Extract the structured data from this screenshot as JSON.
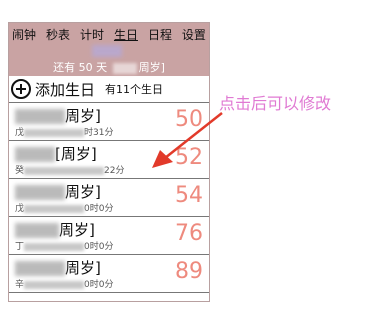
{
  "tabs": [
    "闹钟",
    "秒表",
    "计时",
    "生日",
    "日程",
    "设置"
  ],
  "active_tab": "生日",
  "header": {
    "countdown_prefix": "还有 50 天",
    "countdown_suffix": "周岁]"
  },
  "add_label": "添加生日",
  "count_label": "有11个生日",
  "items": [
    {
      "name_suffix": "周岁]",
      "sub_prefix": "戊",
      "sub_suffix": "时31分",
      "age": "50"
    },
    {
      "name_suffix": "[周岁]",
      "sub_prefix": "癸",
      "sub_suffix": "22分",
      "age": "52"
    },
    {
      "name_suffix": "周岁]",
      "sub_prefix": "戊",
      "sub_suffix": "0时0分",
      "age": "54"
    },
    {
      "name_suffix": "周岁]",
      "sub_prefix": "丁",
      "sub_suffix": "0时0分",
      "age": "76"
    },
    {
      "name_suffix": "周岁]",
      "sub_prefix": "辛",
      "sub_suffix": "0时0分",
      "age": "89"
    }
  ],
  "annotation": "点击后可以修改",
  "colors": {
    "header_bg": "#c9a3a3",
    "age_color": "#ee8a7e",
    "annotation_color": "#e07ad3",
    "arrow_color": "#e23a2a"
  }
}
